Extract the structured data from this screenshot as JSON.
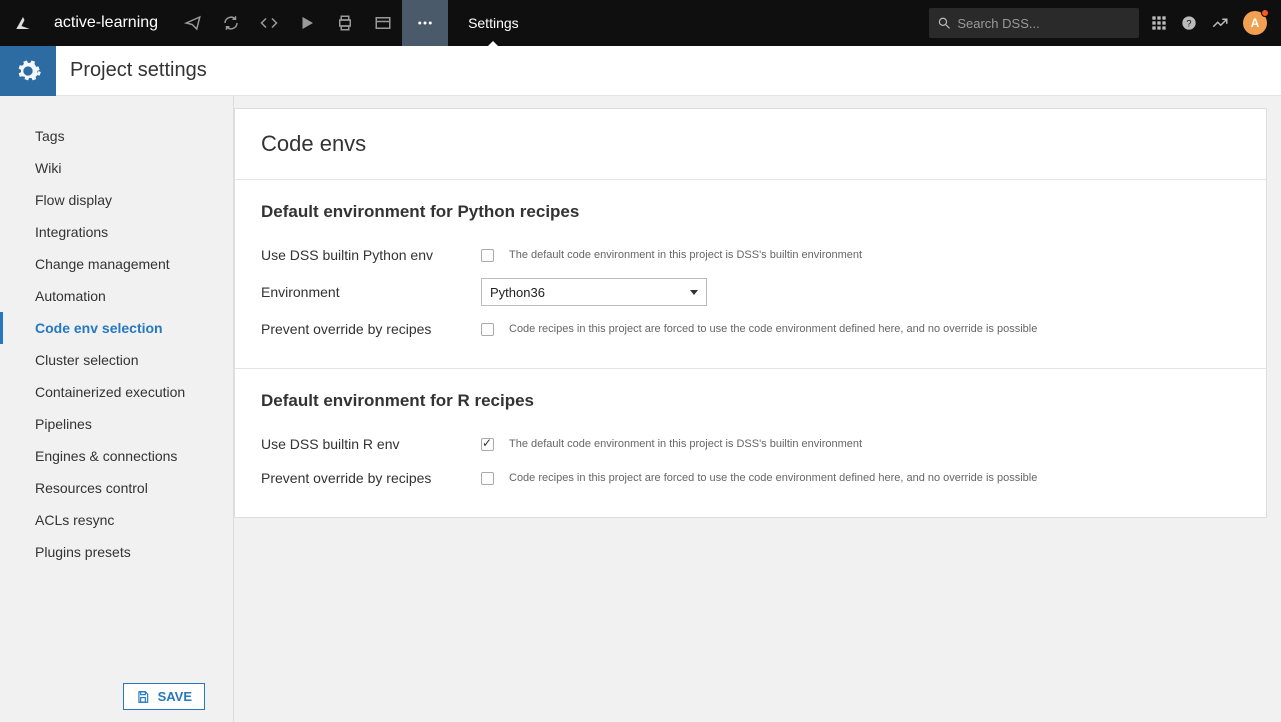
{
  "topbar": {
    "project_name": "active-learning",
    "active_tab": "Settings",
    "search_placeholder": "Search DSS...",
    "avatar_initial": "A"
  },
  "page_title": "Project settings",
  "sidebar": {
    "items": [
      {
        "label": "Tags"
      },
      {
        "label": "Wiki"
      },
      {
        "label": "Flow display"
      },
      {
        "label": "Integrations"
      },
      {
        "label": "Change management"
      },
      {
        "label": "Automation"
      },
      {
        "label": "Code env selection"
      },
      {
        "label": "Cluster selection"
      },
      {
        "label": "Containerized execution"
      },
      {
        "label": "Pipelines"
      },
      {
        "label": "Engines & connections"
      },
      {
        "label": "Resources control"
      },
      {
        "label": "ACLs resync"
      },
      {
        "label": "Plugins presets"
      }
    ],
    "active_index": 6,
    "save_label": "SAVE"
  },
  "content": {
    "title": "Code envs",
    "python": {
      "heading": "Default environment for Python recipes",
      "use_builtin_label": "Use DSS builtin Python env",
      "use_builtin_hint": "The default code environment in this project is DSS's builtin environment",
      "use_builtin_checked": false,
      "env_label": "Environment",
      "env_value": "Python36",
      "prevent_label": "Prevent override by recipes",
      "prevent_hint": "Code recipes in this project are forced to use the code environment defined here, and no override is possible",
      "prevent_checked": false
    },
    "r": {
      "heading": "Default environment for R recipes",
      "use_builtin_label": "Use DSS builtin R env",
      "use_builtin_hint": "The default code environment in this project is DSS's builtin environment",
      "use_builtin_checked": true,
      "prevent_label": "Prevent override by recipes",
      "prevent_hint": "Code recipes in this project are forced to use the code environment defined here, and no override is possible",
      "prevent_checked": false
    }
  }
}
